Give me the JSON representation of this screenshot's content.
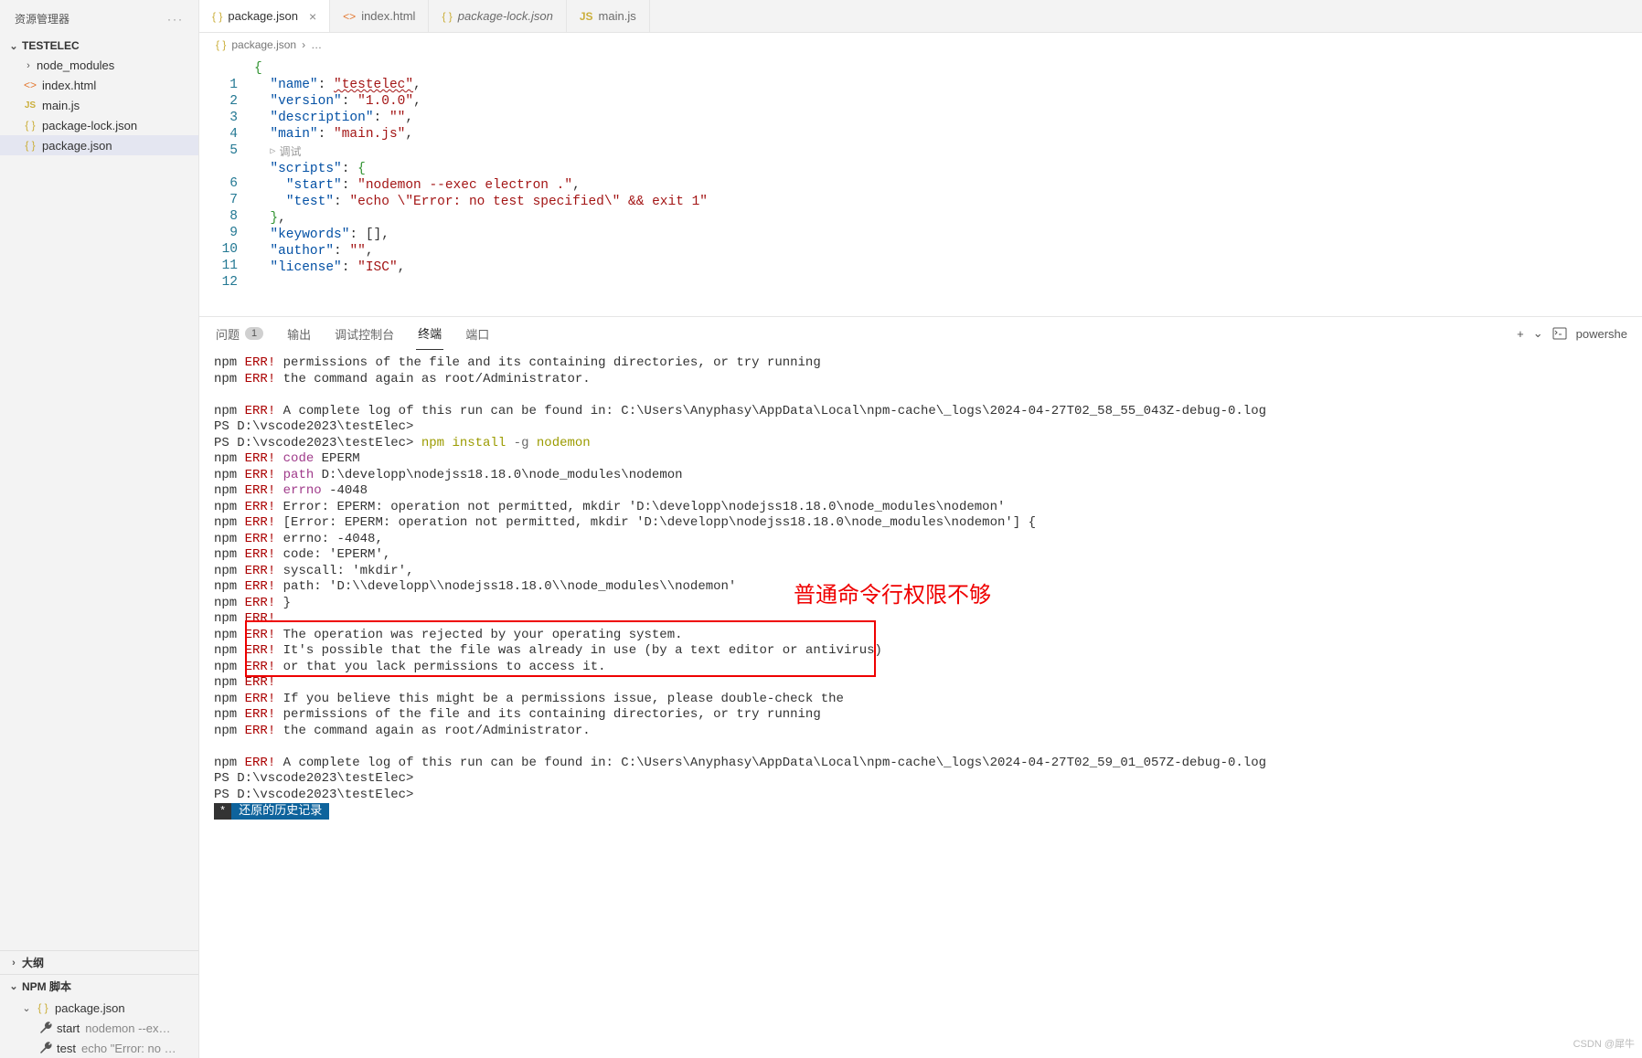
{
  "sidebar": {
    "explorer_label": "资源管理器",
    "project_name": "TESTELEC",
    "files": [
      {
        "name": "node_modules",
        "icon": "folder",
        "chev": "›"
      },
      {
        "name": "index.html",
        "icon": "html",
        "chev": ""
      },
      {
        "name": "main.js",
        "icon": "js",
        "chev": ""
      },
      {
        "name": "package-lock.json",
        "icon": "json",
        "chev": ""
      },
      {
        "name": "package.json",
        "icon": "json",
        "chev": "",
        "selected": true
      }
    ],
    "outline_label": "大纲",
    "npm_label": "NPM 脚本",
    "npm_pkg": "package.json",
    "scripts": [
      {
        "name": "start",
        "cmd": "nodemon --ex…"
      },
      {
        "name": "test",
        "cmd": "echo \"Error: no …"
      }
    ]
  },
  "tabs": [
    {
      "label": "package.json",
      "icon": "{ }",
      "active": true,
      "close": true,
      "italic": false
    },
    {
      "label": "index.html",
      "icon": "<>",
      "active": false,
      "close": false,
      "italic": false
    },
    {
      "label": "package-lock.json",
      "icon": "{ }",
      "active": false,
      "close": false,
      "italic": true
    },
    {
      "label": "main.js",
      "icon": "JS",
      "active": false,
      "close": false,
      "italic": false
    }
  ],
  "breadcrumb": {
    "file": "package.json",
    "sep": "›",
    "more": "…"
  },
  "editor": {
    "lines": [
      "1",
      "2",
      "3",
      "4",
      "5",
      "",
      "6",
      "7",
      "8",
      "9",
      "10",
      "11",
      "12"
    ],
    "codelens": "调试",
    "content": {
      "name_k": "\"name\"",
      "name_v": "\"testelec\"",
      "version_k": "\"version\"",
      "version_v": "\"1.0.0\"",
      "description_k": "\"description\"",
      "description_v": "\"\"",
      "main_k": "\"main\"",
      "main_v": "\"main.js\"",
      "scripts_k": "\"scripts\"",
      "start_k": "\"start\"",
      "start_v": "\"nodemon --exec electron .\"",
      "test_k": "\"test\"",
      "test_v": "\"echo \\\"Error: no test specified\\\" && exit 1\"",
      "keywords_k": "\"keywords\"",
      "author_k": "\"author\"",
      "author_v": "\"\"",
      "license_k": "\"license\"",
      "license_v": "\"ISC\""
    }
  },
  "panel": {
    "tabs": {
      "problems": "问题",
      "problems_count": "1",
      "output": "输出",
      "debug": "调试控制台",
      "terminal": "终端",
      "ports": "端口"
    },
    "right": {
      "shell": "powershe",
      "plus": "+",
      "chev": "⌄"
    }
  },
  "terminal": {
    "l01": "permissions of the file and its containing directories, or try running",
    "l02": "the command again as root/Administrator.",
    "l03": "A complete log of this run can be found in: C:\\Users\\Anyphasy\\AppData\\Local\\npm-cache\\_logs\\2024-04-27T02_58_55_043Z-debug-0.log",
    "ps1": "PS D:\\vscode2023\\testElec>",
    "cmd1": "npm install -g nodemon",
    "cmd1a": "npm install ",
    "cmd1b": "-g",
    "cmd1c": " nodemon",
    "l04": "code EPERM",
    "l05": "path D:\\developp\\nodejss18.18.0\\node_modules\\nodemon",
    "l06": "errno -4048",
    "l07": "Error: EPERM: operation not permitted, mkdir 'D:\\developp\\nodejss18.18.0\\node_modules\\nodemon'",
    "l08": " [Error: EPERM: operation not permitted, mkdir 'D:\\developp\\nodejss18.18.0\\node_modules\\nodemon'] {",
    "l09": "   errno: -4048,",
    "l10": "   code: 'EPERM',",
    "l11": "   syscall: 'mkdir',",
    "l12": "   path: 'D:\\\\developp\\\\nodejss18.18.0\\\\node_modules\\\\nodemon'",
    "l13": " }",
    "l14": "The operation was rejected by your operating system.",
    "l15": "It's possible that the file was already in use (by a text editor or antivirus)",
    "l16": "or that you lack permissions to access it.",
    "l17": "If you believe this might be a permissions issue, please double-check the",
    "l18": "permissions of the file and its containing directories, or try running",
    "l19": "the command again as root/Administrator.",
    "l20": "A complete log of this run can be found in: C:\\Users\\Anyphasy\\AppData\\Local\\npm-cache\\_logs\\2024-04-27T02_59_01_057Z-debug-0.log",
    "ps2": "PS D:\\vscode2023\\testElec>",
    "ps3": "PS D:\\vscode2023\\testElec>",
    "npm": "npm",
    "err": "ERR!",
    "code_k": "code",
    "path_k": "path",
    "errno_k": "errno",
    "history": "还原的历史记录",
    "annotation": "普通命令行权限不够",
    "watermark": "CSDN @犀牛"
  }
}
